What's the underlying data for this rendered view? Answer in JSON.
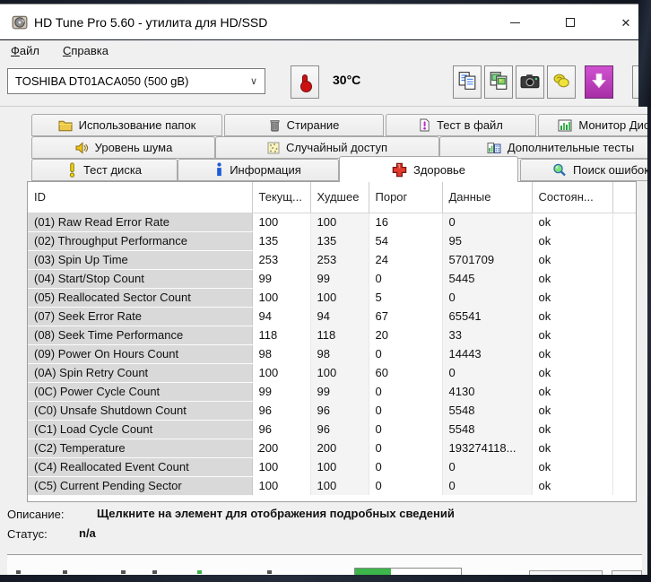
{
  "window": {
    "title": "HD Tune Pro 5.60 - утилита для HD/SSD",
    "app_icon": "hard-disk-icon",
    "controls": [
      "minimize-icon",
      "maximize-icon",
      "close-icon"
    ],
    "close_glyph": "✕"
  },
  "menu": {
    "items": [
      {
        "label": "Файл"
      },
      {
        "label": "Справка"
      }
    ]
  },
  "toolbar": {
    "drive_select": {
      "value": "TOSHIBA DT01ACA050 (500 gB)",
      "chevron": "∨"
    },
    "temperature_button_icon": "thermometer-icon",
    "temperature": "30°C",
    "buttons": [
      {
        "icon": "copy-text-icon"
      },
      {
        "icon": "copy-image-icon"
      },
      {
        "icon": "screenshot-camera-icon"
      },
      {
        "icon": "donate-hands-icon"
      },
      {
        "icon": "update-download-icon"
      }
    ]
  },
  "tabs": {
    "active": "Здоровье",
    "rows": [
      [
        {
          "label": "Использование папок",
          "icon": "folder-icon"
        },
        {
          "label": "Стирание",
          "icon": "trash-icon"
        },
        {
          "label": "Тест в файл",
          "icon": "file-test-icon"
        },
        {
          "label": "Монитор Диска",
          "icon": "disk-monitor-icon"
        }
      ],
      [
        {
          "label": "Уровень шума",
          "icon": "speaker-icon"
        },
        {
          "label": "Случайный доступ",
          "icon": "random-access-icon"
        },
        {
          "label": "Дополнительные тесты",
          "icon": "extra-tests-icon"
        }
      ],
      [
        {
          "label": "Тест диска",
          "icon": "exclamation-icon"
        },
        {
          "label": "Информация",
          "icon": "info-icon"
        },
        {
          "label": "Здоровье",
          "icon": "health-cross-icon"
        },
        {
          "label": "Поиск ошибок",
          "icon": "error-scan-icon"
        }
      ]
    ]
  },
  "table": {
    "columns": [
      "ID",
      "Текущ...",
      "Худшее",
      "Порог",
      "Данные",
      "Состоян..."
    ],
    "rows": [
      {
        "id": "(01) Raw Read Error Rate",
        "current": "100",
        "worst": "100",
        "threshold": "16",
        "data": "0",
        "status": "ok"
      },
      {
        "id": "(02) Throughput Performance",
        "current": "135",
        "worst": "135",
        "threshold": "54",
        "data": "95",
        "status": "ok"
      },
      {
        "id": "(03) Spin Up Time",
        "current": "253",
        "worst": "253",
        "threshold": "24",
        "data": "5701709",
        "status": "ok"
      },
      {
        "id": "(04) Start/Stop Count",
        "current": "99",
        "worst": "99",
        "threshold": "0",
        "data": "5445",
        "status": "ok"
      },
      {
        "id": "(05) Reallocated Sector Count",
        "current": "100",
        "worst": "100",
        "threshold": "5",
        "data": "0",
        "status": "ok"
      },
      {
        "id": "(07) Seek Error Rate",
        "current": "94",
        "worst": "94",
        "threshold": "67",
        "data": "65541",
        "status": "ok"
      },
      {
        "id": "(08) Seek Time Performance",
        "current": "118",
        "worst": "118",
        "threshold": "20",
        "data": "33",
        "status": "ok"
      },
      {
        "id": "(09) Power On Hours Count",
        "current": "98",
        "worst": "98",
        "threshold": "0",
        "data": "14443",
        "status": "ok"
      },
      {
        "id": "(0A) Spin Retry Count",
        "current": "100",
        "worst": "100",
        "threshold": "60",
        "data": "0",
        "status": "ok"
      },
      {
        "id": "(0C) Power Cycle Count",
        "current": "99",
        "worst": "99",
        "threshold": "0",
        "data": "4130",
        "status": "ok"
      },
      {
        "id": "(C0) Unsafe Shutdown Count",
        "current": "96",
        "worst": "96",
        "threshold": "0",
        "data": "5548",
        "status": "ok"
      },
      {
        "id": "(C1) Load Cycle Count",
        "current": "96",
        "worst": "96",
        "threshold": "0",
        "data": "5548",
        "status": "ok"
      },
      {
        "id": "(C2) Temperature",
        "current": "200",
        "worst": "200",
        "threshold": "0",
        "data": "193274118...",
        "status": "ok"
      },
      {
        "id": "(C4) Reallocated Event Count",
        "current": "100",
        "worst": "100",
        "threshold": "0",
        "data": "0",
        "status": "ok"
      },
      {
        "id": "(C5) Current Pending Sector",
        "current": "100",
        "worst": "100",
        "threshold": "0",
        "data": "0",
        "status": "ok"
      }
    ]
  },
  "footer": {
    "description_label": "Описание:",
    "description_value": "Щелкните на элемент для отображения подробных сведений",
    "status_label": "Статус:",
    "status_value": "n/a"
  },
  "colors": {
    "accent_update_button": "#c03cc8",
    "health_cross_red": "#e23b2e",
    "progress_green": "#3cb54a",
    "chrome_gray": "#f0f0f0",
    "id_column_gray": "#d9d9d9"
  }
}
